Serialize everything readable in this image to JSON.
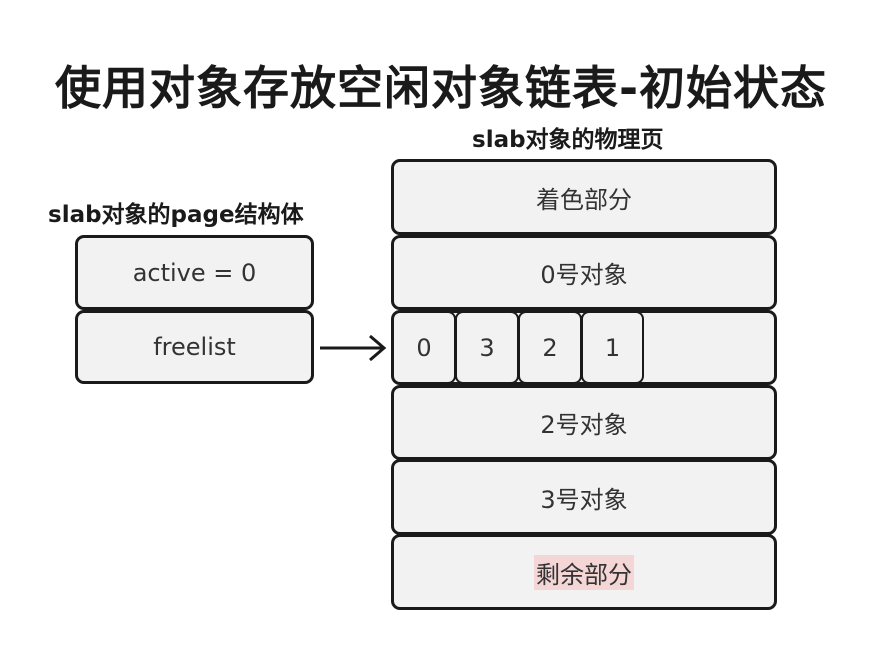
{
  "title": "使用对象存放空闲对象链表-初始状态",
  "page_struct": {
    "heading": "slab对象的page结构体",
    "fields": [
      "active = 0",
      "freelist"
    ]
  },
  "physical_page": {
    "heading": "slab对象的物理页",
    "coloring": "着色部分",
    "object0": "0号对象",
    "freelist_cells": [
      "0",
      "3",
      "2",
      "1"
    ],
    "object2": "2号对象",
    "object3": "3号对象",
    "remaining": "剩余部分"
  },
  "colors": {
    "border": "#1a1a1a",
    "box_fill": "#f2f2f2",
    "highlight": "#f5d6d6"
  }
}
